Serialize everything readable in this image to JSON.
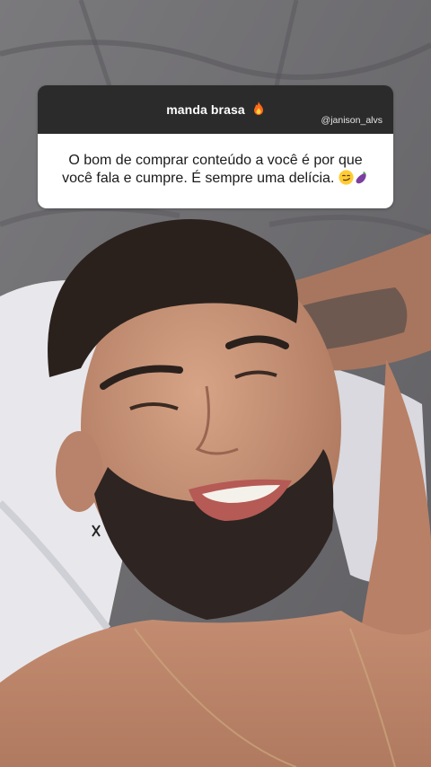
{
  "story": {
    "question_title": "manda brasa",
    "question_title_icon": "fire-icon",
    "username": "@janison_alvs",
    "answer_text": "O bom de comprar conteúdo a você é por que você fala e cumpre. É sempre uma delícia.",
    "answer_emojis": [
      "smirk-emoji",
      "eggplant-emoji"
    ]
  },
  "colors": {
    "header_bg": "#2b2b2b",
    "body_bg": "#ffffff",
    "text": "#1a1a1a"
  }
}
